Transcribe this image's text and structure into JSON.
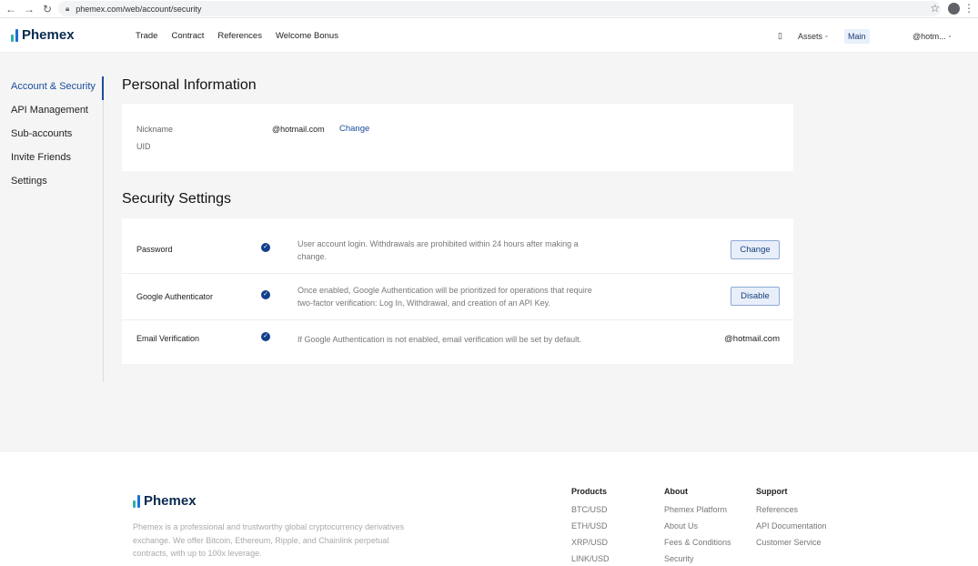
{
  "browser": {
    "back": "←",
    "forward": "→",
    "reload": "↻",
    "url": "phemex.com/web/account/security",
    "star": "☆",
    "menu": "⋮"
  },
  "brand": {
    "name": "Phemex",
    "colors": [
      "#2ab3a4",
      "#1d6fd8",
      "#0b2a4f"
    ]
  },
  "topnav": {
    "links": [
      "Trade",
      "Contract",
      "References",
      "Welcome Bonus"
    ],
    "mobile_icon": "▯",
    "assets": "Assets",
    "caret": "▫",
    "main": "Main",
    "user": "@hotm..."
  },
  "sidebar": {
    "items": [
      {
        "label": "Account & Security",
        "active": true
      },
      {
        "label": "API Management"
      },
      {
        "label": "Sub-accounts"
      },
      {
        "label": "Invite Friends"
      },
      {
        "label": "Settings"
      }
    ]
  },
  "personal": {
    "title": "Personal Information",
    "nickname_label": "Nickname",
    "nickname_value": "@hotmail.com",
    "change_link": "Change",
    "uid_label": "UID"
  },
  "security": {
    "title": "Security Settings",
    "check": "✓",
    "rows": [
      {
        "label": "Password",
        "desc": "User account login. Withdrawals are prohibited within 24 hours after making a change.",
        "action": "Change"
      },
      {
        "label": "Google Authenticator",
        "desc": "Once enabled, Google Authentication will be prioritized for operations that require two-factor verification: Log In, Withdrawal, and creation of an API Key.",
        "action": "Disable"
      },
      {
        "label": "Email Verification",
        "desc": "If Google Authentication is not enabled, email verification will be set by default.",
        "value": "@hotmail.com"
      }
    ]
  },
  "footer": {
    "logo": "Phemex",
    "desc": "Phemex is a professional and trustworthy global cryptocurrency derivatives exchange. We offer Bitcoin, Ethereum, Ripple, and Chainlink perpetual contracts, with up to 100x leverage.",
    "columns": [
      {
        "title": "Products",
        "links": [
          "BTC/USD",
          "ETH/USD",
          "XRP/USD",
          "LINK/USD"
        ]
      },
      {
        "title": "About",
        "links": [
          "Phemex Platform",
          "About Us",
          "Fees & Conditions",
          "Security"
        ]
      },
      {
        "title": "Support",
        "links": [
          "References",
          "API Documentation",
          "Customer Service"
        ]
      }
    ]
  }
}
